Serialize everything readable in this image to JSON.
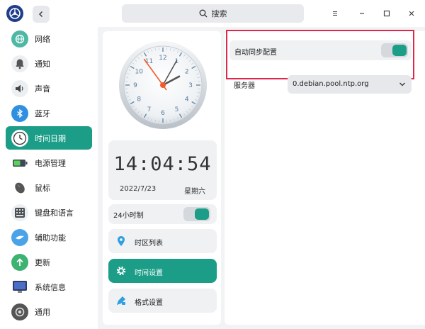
{
  "window": {
    "search_placeholder": "搜索"
  },
  "sidebar": {
    "items": [
      {
        "label": "网络",
        "icon": "network-icon"
      },
      {
        "label": "通知",
        "icon": "bell-icon"
      },
      {
        "label": "声音",
        "icon": "speaker-icon"
      },
      {
        "label": "蓝牙",
        "icon": "bluetooth-icon"
      },
      {
        "label": "时间日期",
        "icon": "clock-icon",
        "active": true
      },
      {
        "label": "电源管理",
        "icon": "battery-icon"
      },
      {
        "label": "鼠标",
        "icon": "mouse-icon"
      },
      {
        "label": "键盘和语言",
        "icon": "keyboard-icon"
      },
      {
        "label": "辅助功能",
        "icon": "accessibility-icon"
      },
      {
        "label": "更新",
        "icon": "update-icon"
      },
      {
        "label": "系统信息",
        "icon": "system-info-icon"
      },
      {
        "label": "通用",
        "icon": "general-icon"
      }
    ]
  },
  "clock": {
    "time": "14:04:54",
    "date": "2022/7/23",
    "weekday": "星期六",
    "hour": 14,
    "minute": 4,
    "second": 54
  },
  "format24": {
    "label": "24小时制",
    "enabled": true
  },
  "menu": {
    "timezone_label": "时区列表",
    "time_settings_label": "时间设置",
    "format_settings_label": "格式设置"
  },
  "settings": {
    "auto_sync_label": "自动同步配置",
    "auto_sync_enabled": true,
    "server_label": "服务器",
    "server_value": "0.debian.pool.ntp.org"
  },
  "colors": {
    "accent": "#1b9d87",
    "highlight": "#e0264a"
  }
}
